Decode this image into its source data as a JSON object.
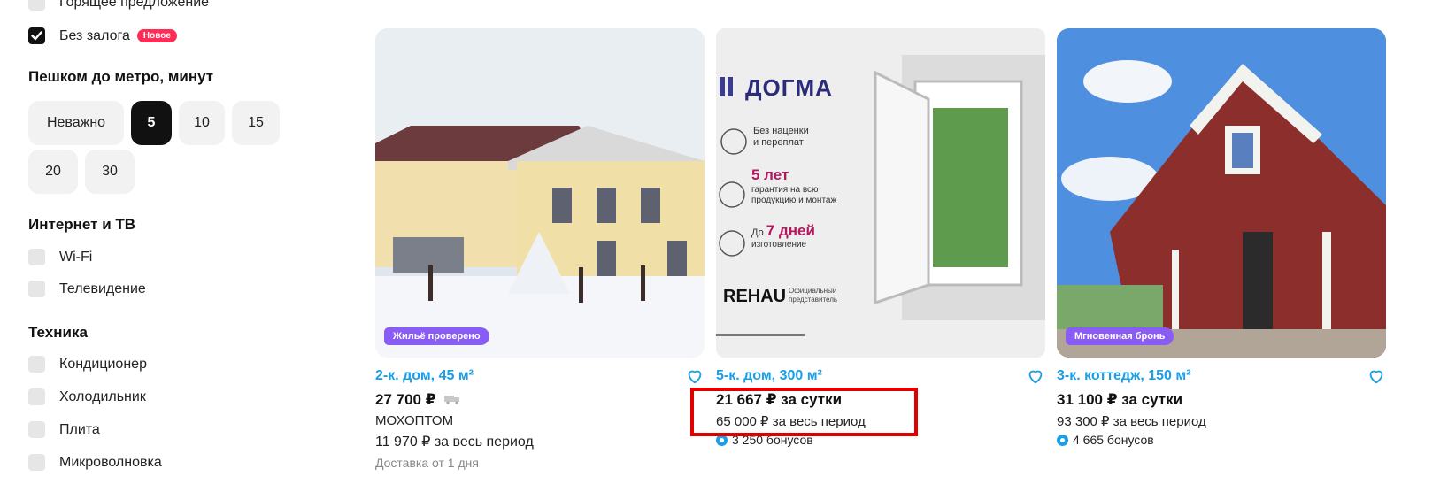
{
  "sidebar": {
    "hot_offer_label": "Горящее предложение",
    "no_deposit_label": "Без залога",
    "no_deposit_badge": "Новое",
    "metro_title": "Пешком до метро, минут",
    "metro_options": [
      "Неважно",
      "5",
      "10",
      "15",
      "20",
      "30"
    ],
    "metro_selected": "5",
    "internet_title": "Интернет и ТВ",
    "internet_items": [
      "Wi-Fi",
      "Телевидение"
    ],
    "tech_title": "Техника",
    "tech_items": [
      "Кондиционер",
      "Холодильник",
      "Плита",
      "Микроволновка"
    ]
  },
  "cards": [
    {
      "photo_badge": "Жильё проверено",
      "title": "2-к. дом, 45 м²",
      "price": "27 700 ₽",
      "seller": "МОХОПТОМ",
      "period_price": "11 970 ₽ за весь период",
      "delivery": "Доставка от 1 дня"
    },
    {
      "ad_brand": "ДОГМА",
      "ad_line1": "Без наценки",
      "ad_line2": "и переплат",
      "ad_years": "5 лет",
      "ad_warranty1": "гарантия на всю",
      "ad_warranty2": "продукцию и монтаж",
      "ad_days_prefix": "До",
      "ad_days": "7 дней",
      "ad_days_suffix": "изготовление",
      "ad_rehau": "REHAU",
      "ad_official1": "Официальный",
      "ad_official2": "представитель",
      "title": "5-к. дом, 300 м²",
      "price": "21 667 ₽ за сутки",
      "period_price": "65 000 ₽ за весь период",
      "bonus": "3 250 бонусов"
    },
    {
      "photo_badge": "Мгновенная бронь",
      "title": "3-к. коттедж, 150 м²",
      "price": "31 100 ₽ за сутки",
      "period_price": "93 300 ₽ за весь период",
      "bonus": "4 665 бонусов"
    }
  ],
  "colors": {
    "accent": "#1a9ee5",
    "highlight": "#e00000",
    "badge_violet": "#8a5cf6",
    "badge_new": "#ff2d55"
  }
}
